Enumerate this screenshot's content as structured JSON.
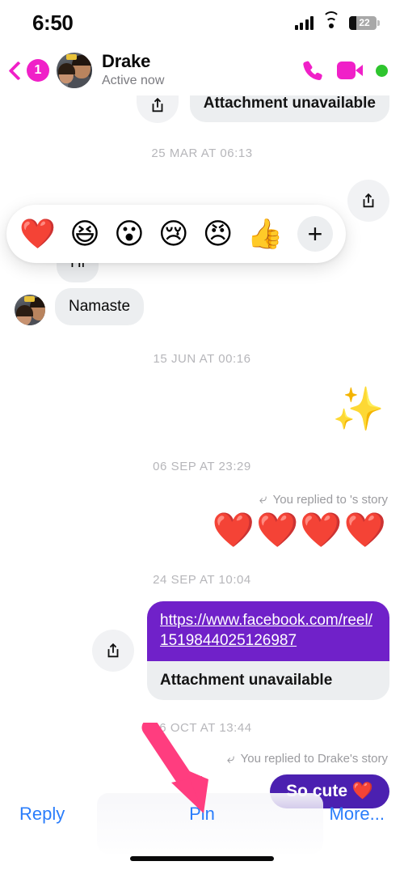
{
  "status_bar": {
    "time": "6:50",
    "battery_level": "22",
    "icons": [
      "cellular-signal-icon",
      "wifi-icon",
      "battery-icon"
    ]
  },
  "header": {
    "back_badge": "1",
    "contact_name": "Drake",
    "presence": "Active now",
    "accent_color": "#f020c8",
    "online_dot_color": "#2ec52e",
    "actions": [
      "audio-call-icon",
      "video-call-icon"
    ]
  },
  "conversation": {
    "clipped_top_message": {
      "text": "Attachment unavailable",
      "has_share_button": true
    },
    "timestamps": {
      "t1": "25 MAR AT 06:13",
      "t2": "15 JUN AT 00:16",
      "t3": "06 SEP AT 23:29",
      "t4": "24 SEP AT 10:04",
      "t5": "26 OCT AT 13:44"
    },
    "messages": [
      {
        "id": "hi",
        "side": "in",
        "text": "Hi"
      },
      {
        "id": "namaste",
        "side": "in",
        "text": "Namaste"
      },
      {
        "id": "sparkles",
        "side": "out",
        "text": "✨"
      },
      {
        "id": "hearts",
        "side": "out",
        "text": "❤️❤️❤️❤️"
      },
      {
        "id": "socute",
        "side": "out",
        "text": "So cute ❤️"
      }
    ],
    "story_reply_1": "You replied to 's story",
    "story_reply_2": "You replied to Drake's story",
    "link_message": {
      "url": "https://www.facebook.com/reel/1519844025126987",
      "attachment_status": "Attachment unavailable",
      "url_bubble_color": "#7021c9"
    },
    "outgoing_bubble_color": "#4b20b0",
    "incoming_bubble_color": "#eceef0"
  },
  "reaction_picker": {
    "emojis": [
      "❤️",
      "😆",
      "😮",
      "😢",
      "😠",
      "👍"
    ],
    "emoji_names": [
      "heart-reaction",
      "laugh-reaction",
      "wow-reaction",
      "sad-reaction",
      "angry-reaction",
      "thumbs-up-reaction"
    ],
    "more_label": "+"
  },
  "bottom_actions": {
    "reply": "Reply",
    "pin": "Pin",
    "more": "More...",
    "link_color": "#2a7dfb"
  },
  "annotation": {
    "arrow_color": "#ff3d7f",
    "points_at": "Pin"
  }
}
